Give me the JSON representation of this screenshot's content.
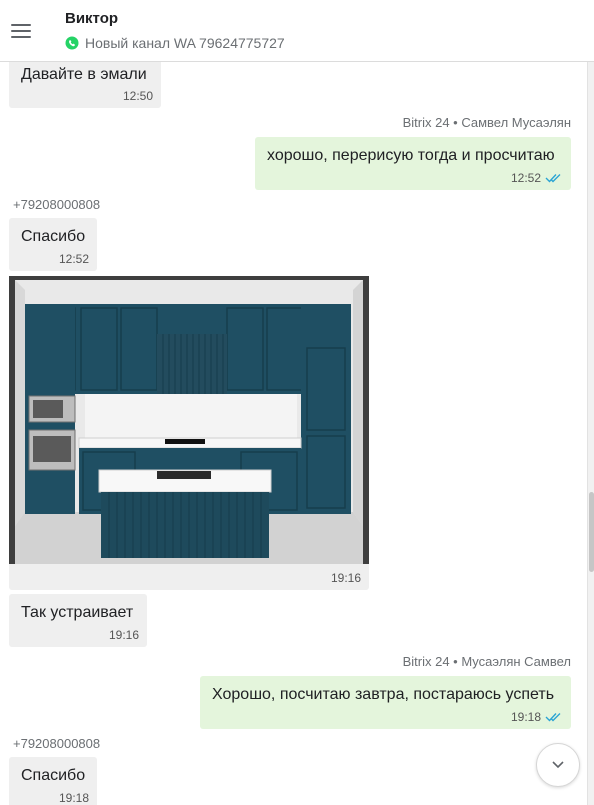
{
  "header": {
    "contact_name": "Виктор",
    "channel": "Новый канал WA 79624775727",
    "menu_icon": "hamburger-menu-icon",
    "channel_icon": "whatsapp-icon"
  },
  "messages": [
    {
      "direction": "in",
      "text": "Давайте в эмали",
      "time": "12:50"
    },
    {
      "direction": "out",
      "sender": "Bitrix 24 • Самвел Мусаэлян",
      "text": "хорошо, перерисую тогда и просчитаю",
      "time": "12:52",
      "status": "read"
    },
    {
      "direction": "in",
      "sender": "+79208000808",
      "text": "Спасибо",
      "time": "12:52"
    },
    {
      "direction": "in",
      "type": "image",
      "image_desc": "kitchen-render",
      "time": "19:16"
    },
    {
      "direction": "in",
      "text": "Так устраивает",
      "time": "19:16"
    },
    {
      "direction": "out",
      "sender": "Bitrix 24 • Мусаэлян Самвел",
      "text": "Хорошо, посчитаю завтра, постараюсь успеть",
      "time": "19:18",
      "status": "read"
    },
    {
      "direction": "in",
      "sender": "+79208000808",
      "text": "Спасибо",
      "time": "19:18"
    }
  ],
  "controls": {
    "scroll_down_icon": "chevron-down-icon"
  },
  "colors": {
    "incoming_bubble": "#efefef",
    "outgoing_bubble": "#e4f5dc",
    "read_check": "#2aa4d4",
    "whatsapp": "#25d366"
  }
}
